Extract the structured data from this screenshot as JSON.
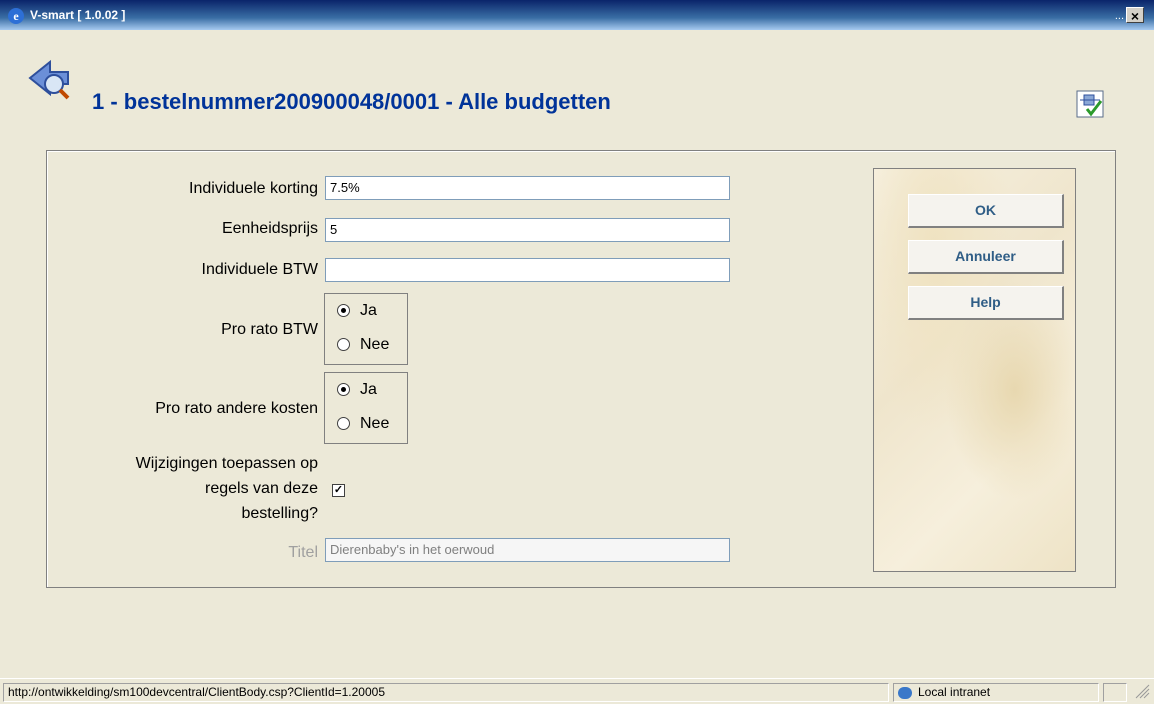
{
  "window": {
    "title": "V-smart [ 1.0.02 ]",
    "app_icon": "ie-icon",
    "min_label": "...",
    "close_label": "×"
  },
  "header": {
    "title": "1 - bestelnummer200900048/0001 - Alle budgetten",
    "back_icon": "back-search-icon",
    "corner_icon": "checklist-icon"
  },
  "form": {
    "individuele_korting": {
      "label": "Individuele korting",
      "value": "7.5%"
    },
    "eenheidsprijs": {
      "label": "Eenheidsprijs",
      "value": "5"
    },
    "individuele_btw": {
      "label": "Individuele BTW",
      "value": ""
    },
    "pro_rato_btw": {
      "label": "Pro rato BTW",
      "options": [
        "Ja",
        "Nee"
      ],
      "selected": "Ja"
    },
    "pro_rato_andere_kosten": {
      "label": "Pro rato andere kosten",
      "options": [
        "Ja",
        "Nee"
      ],
      "selected": "Ja"
    },
    "wijzigingen": {
      "label_lines": [
        "Wijzigingen toepassen op",
        "regels van deze",
        "bestelling?"
      ],
      "checked": true
    },
    "titel": {
      "label": "Titel",
      "value": "Dierenbaby's in het oerwoud"
    }
  },
  "buttons": {
    "ok": "OK",
    "cancel": "Annuleer",
    "help": "Help"
  },
  "status": {
    "url": "http://ontwikkelding/sm100devcentral/ClientBody.csp?ClientId=1.20005",
    "zone": "Local intranet"
  }
}
